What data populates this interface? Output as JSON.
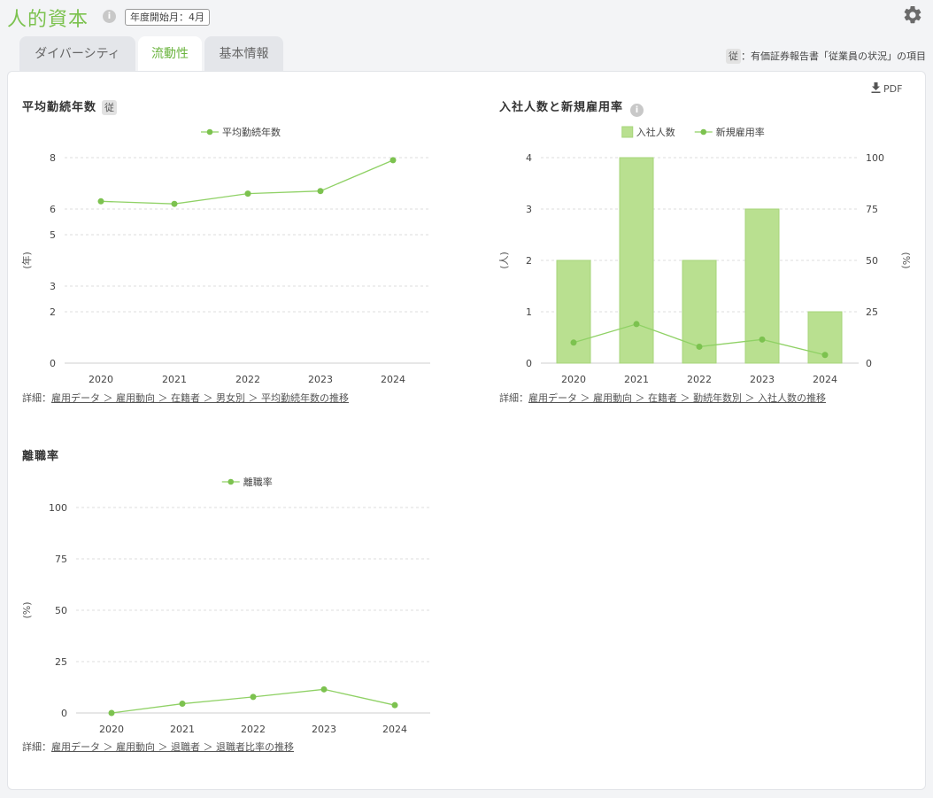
{
  "header": {
    "title": "人的資本",
    "info_glyph": "i",
    "fiscal_start": "年度開始月：4月",
    "settings_icon": "gear-icon"
  },
  "tabs": [
    {
      "label": "ダイバーシティ",
      "active": false
    },
    {
      "label": "流動性",
      "active": true
    },
    {
      "label": "基本情報",
      "active": false
    }
  ],
  "legend_note": {
    "badge": "従",
    "text": "：有価証券報告書「従業員の状況」の項目"
  },
  "pdf": {
    "label": "PDF",
    "icon": "download-icon"
  },
  "colors": {
    "accent": "#7cc24f",
    "line": "#8fd165",
    "point": "#7cc24f",
    "bar_fill": "#b9e090",
    "bar_stroke": "#a6d57a",
    "grid": "#dddddd",
    "axis_text": "#444444"
  },
  "sections": {
    "tenure": {
      "title": "平均勤続年数",
      "badge": "従",
      "detail_prefix": "詳細：",
      "detail_link": "雇用データ ＞ 雇用動向 ＞ 在籍者 ＞ 男女別 ＞ 平均勤続年数の推移"
    },
    "hiring": {
      "title": "入社人数と新規雇用率",
      "info_glyph": "i",
      "detail_prefix": "詳細：",
      "detail_link": "雇用データ ＞ 雇用動向 ＞ 在籍者 ＞ 勤続年数別 ＞ 入社人数の推移"
    },
    "turnover": {
      "title": "離職率",
      "detail_prefix": "詳細：",
      "detail_link": "雇用データ ＞ 雇用動向 ＞ 退職者 ＞ 退職者比率の推移"
    }
  },
  "chart_data": [
    {
      "id": "tenure",
      "type": "line",
      "categories": [
        "2020",
        "2021",
        "2022",
        "2023",
        "2024"
      ],
      "series": [
        {
          "name": "平均勤続年数",
          "values": [
            6.3,
            6.2,
            6.6,
            6.7,
            7.9
          ]
        }
      ],
      "ylabel": "(年)",
      "ylim": [
        0,
        8
      ],
      "yticks": [
        0,
        2,
        3,
        5,
        6,
        8
      ],
      "grid": true,
      "legend": "top-center"
    },
    {
      "id": "hiring",
      "type": "bar",
      "categories": [
        "2020",
        "2021",
        "2022",
        "2023",
        "2024"
      ],
      "series": [
        {
          "name": "入社人数",
          "type": "bar",
          "axis": "left",
          "values": [
            2,
            4,
            2,
            3,
            1
          ]
        },
        {
          "name": "新規雇用率",
          "type": "line",
          "axis": "right",
          "values": [
            10,
            19,
            8,
            11.5,
            4
          ]
        }
      ],
      "ylabel": "(人)",
      "ylabel_right": "(%)",
      "ylim": [
        0,
        4
      ],
      "ylim_right": [
        0,
        100
      ],
      "yticks": [
        0,
        1,
        2,
        3,
        4
      ],
      "yticks_right": [
        0,
        25,
        50,
        75,
        100
      ],
      "grid": true,
      "legend": "top-center"
    },
    {
      "id": "turnover",
      "type": "line",
      "categories": [
        "2020",
        "2021",
        "2022",
        "2023",
        "2024"
      ],
      "series": [
        {
          "name": "離職率",
          "values": [
            0,
            4.5,
            7.8,
            11.5,
            3.8
          ]
        }
      ],
      "ylabel": "(%)",
      "ylim": [
        0,
        100
      ],
      "yticks": [
        0,
        25,
        50,
        75,
        100
      ],
      "grid": true,
      "legend": "top-center"
    }
  ]
}
